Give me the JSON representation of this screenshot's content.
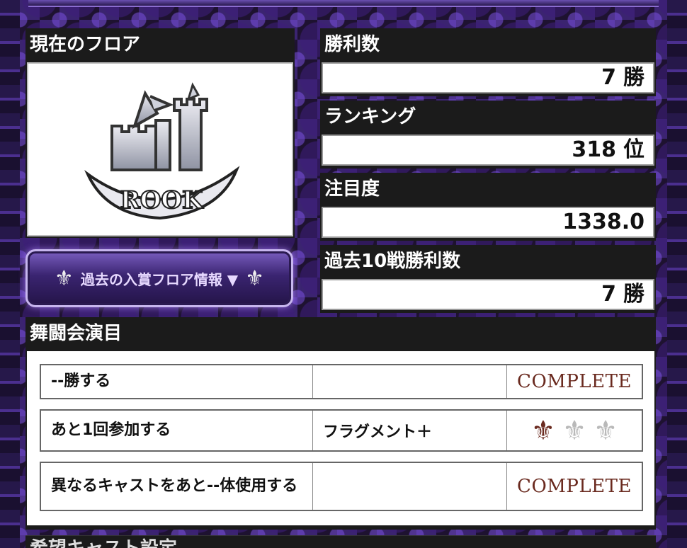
{
  "floor": {
    "header": "現在のフロア",
    "emblem_text": "ROOK"
  },
  "stats": [
    {
      "label": "勝利数",
      "value": "7",
      "unit": "勝"
    },
    {
      "label": "ランキング",
      "value": "318",
      "unit": "位"
    },
    {
      "label": "注目度",
      "value": "1338.0",
      "unit": ""
    },
    {
      "label": "過去10戦勝利数",
      "value": "7",
      "unit": "勝"
    }
  ],
  "past_button": {
    "label": "過去の入賞フロア情報 ▼",
    "left_icon": "fleur-de-lis-icon",
    "right_icon": "fleur-de-lis-icon"
  },
  "events": {
    "header": "舞闘会演目",
    "rows": [
      {
        "task": "--勝する",
        "reward": "",
        "status": "COMPLETE"
      },
      {
        "task": "あと1回参加する",
        "reward": "フラグメント＋",
        "status": "",
        "progress_filled": 1,
        "progress_total": 3
      },
      {
        "task": "異なるキャストをあと--体使用する",
        "reward": "",
        "status": "COMPLETE"
      }
    ]
  },
  "next_section": {
    "header": "希望キャスト設定"
  },
  "colors": {
    "panel": "#1b1b1b",
    "complete": "#6a2a1f",
    "frame": "#3b2470"
  }
}
